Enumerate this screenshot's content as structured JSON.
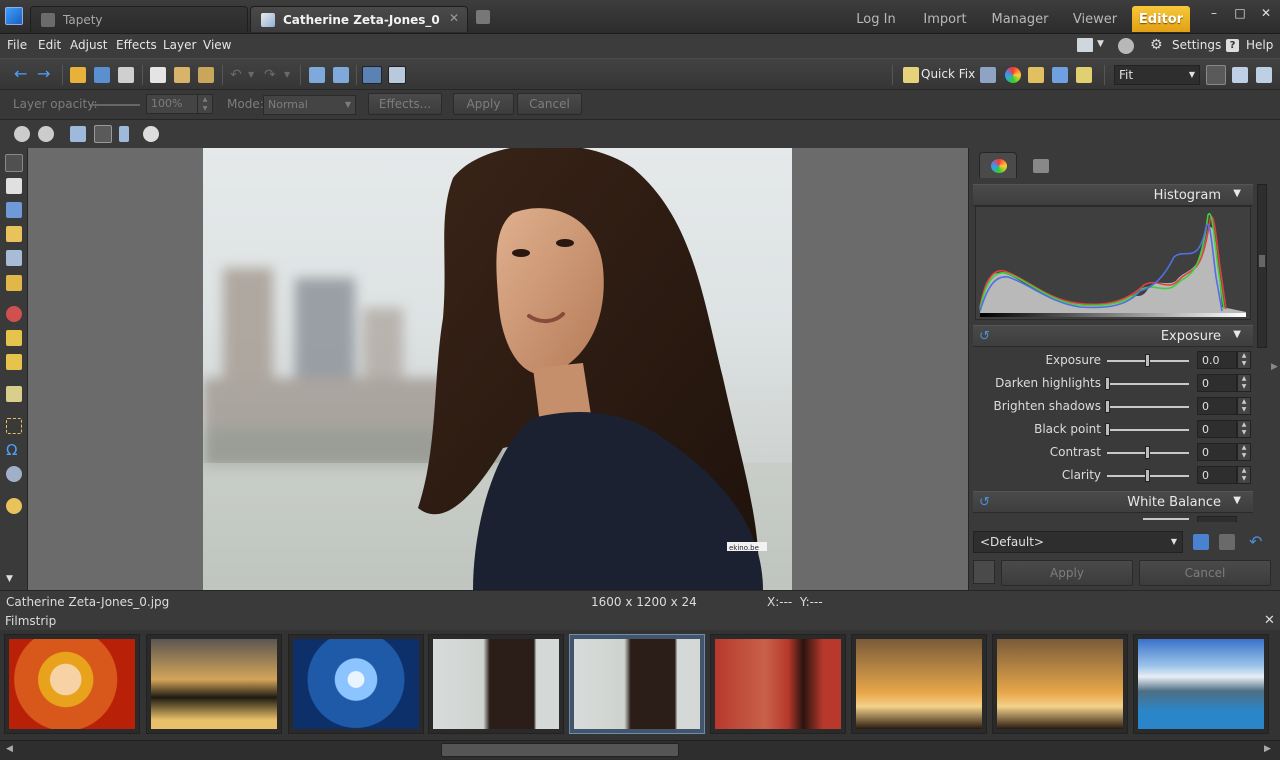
{
  "tabs": [
    {
      "label": "Tapety"
    },
    {
      "label": "Catherine Zeta-Jones_0"
    }
  ],
  "modes": [
    "Log In",
    "Import",
    "Manager",
    "Viewer",
    "Editor"
  ],
  "window_buttons": {
    "minimize": "–",
    "maximize": "□",
    "close": "✕"
  },
  "menu": [
    "File",
    "Edit",
    "Adjust",
    "Effects",
    "Layer",
    "View"
  ],
  "menu_right": {
    "settings": "Settings",
    "help": "Help"
  },
  "toolbar": {
    "quick_fix": "Quick Fix",
    "zoom_select": "Fit"
  },
  "options": {
    "layer_opacity_label": "Layer opacity:",
    "layer_opacity_value": "100%",
    "mode_label": "Mode:",
    "mode_value": "Normal",
    "effects_button": "Effects...",
    "apply_button": "Apply",
    "cancel_button": "Cancel"
  },
  "panel": {
    "histogram_title": "Histogram",
    "exposure_title": "Exposure",
    "white_balance_title": "White Balance",
    "sliders": [
      {
        "label": "Exposure",
        "value": "0.0",
        "level": 0.5
      },
      {
        "label": "Darken highlights",
        "value": "0",
        "level": 0
      },
      {
        "label": "Brighten shadows",
        "value": "0",
        "level": 0
      },
      {
        "label": "Black point",
        "value": "0",
        "level": 0
      },
      {
        "label": "Contrast",
        "value": "0",
        "level": 0.5
      },
      {
        "label": "Clarity",
        "value": "0",
        "level": 0.5
      }
    ],
    "preset": "<Default>",
    "apply_button": "Apply",
    "cancel_button": "Cancel"
  },
  "photo": {
    "watermark": "ekino.be"
  },
  "status": {
    "filename": "Catherine Zeta-Jones_0.jpg",
    "dimensions": "1600 x 1200 x 24",
    "coords": "X:---  Y:---"
  },
  "filmstrip": {
    "title": "Filmstrip",
    "close": "✕"
  },
  "colors": {
    "accent": "#f2b52a",
    "selection": "#42556b"
  }
}
